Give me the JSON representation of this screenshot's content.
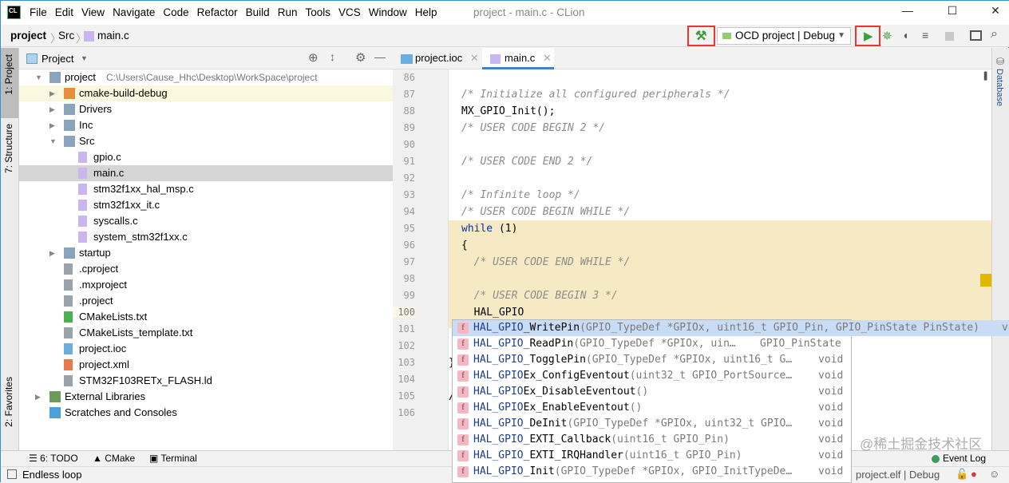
{
  "window": {
    "title": "project - main.c - CLion",
    "logo": "CL"
  },
  "menu": [
    "File",
    "Edit",
    "View",
    "Navigate",
    "Code",
    "Refactor",
    "Build",
    "Run",
    "Tools",
    "VCS",
    "Window",
    "Help"
  ],
  "breadcrumb": [
    "project",
    "Src",
    "main.c"
  ],
  "toolbar": {
    "run_config": "OCD project | Debug",
    "icons": [
      "hammer-build-icon",
      "run-icon",
      "debug-icon",
      "coverage-icon",
      "profile-icon",
      "stop-icon",
      "terminal-icon",
      "search-icon"
    ],
    "highlight_color": "#e33333"
  },
  "project_pane": {
    "title": "Project",
    "tree": [
      {
        "label": "project",
        "extra": "C:\\Users\\Cause_Hhc\\Desktop\\WorkSpace\\project",
        "depth": 0,
        "arrow": "down",
        "icon": "folder"
      },
      {
        "label": "cmake-build-debug",
        "depth": 1,
        "arrow": "right",
        "icon": "folder-orange"
      },
      {
        "label": "Drivers",
        "depth": 1,
        "arrow": "right",
        "icon": "folder"
      },
      {
        "label": "Inc",
        "depth": 1,
        "arrow": "right",
        "icon": "folder"
      },
      {
        "label": "Src",
        "depth": 1,
        "arrow": "down",
        "icon": "folder"
      },
      {
        "label": "gpio.c",
        "depth": 2,
        "icon": "c-file"
      },
      {
        "label": "main.c",
        "depth": 2,
        "icon": "c-file",
        "selected": true
      },
      {
        "label": "stm32f1xx_hal_msp.c",
        "depth": 2,
        "icon": "c-file"
      },
      {
        "label": "stm32f1xx_it.c",
        "depth": 2,
        "icon": "c-file"
      },
      {
        "label": "syscalls.c",
        "depth": 2,
        "icon": "c-file"
      },
      {
        "label": "system_stm32f1xx.c",
        "depth": 2,
        "icon": "c-file"
      },
      {
        "label": "startup",
        "depth": 1,
        "arrow": "right",
        "icon": "folder"
      },
      {
        "label": ".cproject",
        "depth": 1,
        "icon": "text-file"
      },
      {
        "label": ".mxproject",
        "depth": 1,
        "icon": "text-file"
      },
      {
        "label": ".project",
        "depth": 1,
        "icon": "text-file"
      },
      {
        "label": "CMakeLists.txt",
        "depth": 1,
        "icon": "cmake-file"
      },
      {
        "label": "CMakeLists_template.txt",
        "depth": 1,
        "icon": "text-file"
      },
      {
        "label": "project.ioc",
        "depth": 1,
        "icon": "ioc-file"
      },
      {
        "label": "project.xml",
        "depth": 1,
        "icon": "xml-file"
      },
      {
        "label": "STM32F103RETx_FLASH.ld",
        "depth": 1,
        "icon": "text-file"
      },
      {
        "label": "External Libraries",
        "depth": 0,
        "arrow": "right",
        "icon": "library"
      },
      {
        "label": "Scratches and Consoles",
        "depth": 0,
        "icon": "scratches"
      }
    ]
  },
  "side_tabs": {
    "left": [
      "1: Project",
      "7: Structure",
      "2: Favorites"
    ],
    "right": [
      "Database"
    ]
  },
  "editor": {
    "tabs": [
      {
        "label": "project.ioc",
        "active": false
      },
      {
        "label": "main.c",
        "active": true
      }
    ],
    "lines": [
      {
        "n": "86",
        "t": ""
      },
      {
        "n": "87",
        "t": "/* Initialize all configured peripherals */",
        "c": "cm"
      },
      {
        "n": "88",
        "t": "MX_GPIO_Init();"
      },
      {
        "n": "89",
        "t": "/* USER CODE BEGIN 2 */",
        "c": "cm"
      },
      {
        "n": "90",
        "t": ""
      },
      {
        "n": "91",
        "t": "/* USER CODE END 2 */",
        "c": "cm"
      },
      {
        "n": "92",
        "t": ""
      },
      {
        "n": "93",
        "t": "/* Infinite loop */",
        "c": "cm"
      },
      {
        "n": "94",
        "t": "/* USER CODE BEGIN WHILE */",
        "c": "cm"
      },
      {
        "n": "95",
        "t": "while (1)",
        "c": "kw"
      },
      {
        "n": "96",
        "t": "{"
      },
      {
        "n": "97",
        "t": "  /* USER CODE END WHILE */",
        "c": "cm"
      },
      {
        "n": "98",
        "t": ""
      },
      {
        "n": "99",
        "t": "  /* USER CODE BEGIN 3 */",
        "c": "cm"
      },
      {
        "n": "100",
        "t": "  HAL_GPIO"
      },
      {
        "n": "101",
        "t": ""
      },
      {
        "n": "102",
        "t": ""
      },
      {
        "n": "103",
        "t": "}"
      },
      {
        "n": "104",
        "t": ""
      },
      {
        "n": "105",
        "t": "/"
      },
      {
        "n": "106",
        "t": ""
      }
    ]
  },
  "completion": [
    {
      "prefix": "HAL_GPIO",
      "rest": "_WritePin",
      "sig": "(GPIO_TypeDef *GPIOx, uint16_t GPIO_Pin, GPIO_PinState PinState)",
      "ret": "v"
    },
    {
      "prefix": "HAL_GPIO",
      "rest": "_ReadPin",
      "sig": "(GPIO_TypeDef *GPIOx, uin…",
      "ret": "GPIO_PinState"
    },
    {
      "prefix": "HAL_GPIO",
      "rest": "_TogglePin",
      "sig": "(GPIO_TypeDef *GPIOx, uint16_t G…",
      "ret": "void"
    },
    {
      "prefix": "HAL_GPIO",
      "rest": "Ex_ConfigEventout",
      "sig": "(uint32_t GPIO_PortSource…",
      "ret": "void"
    },
    {
      "prefix": "HAL_GPIO",
      "rest": "Ex_DisableEventout",
      "sig": "()",
      "ret": "void"
    },
    {
      "prefix": "HAL_GPIO",
      "rest": "Ex_EnableEventout",
      "sig": "()",
      "ret": "void"
    },
    {
      "prefix": "HAL_GPIO",
      "rest": "_DeInit",
      "sig": "(GPIO_TypeDef *GPIOx, uint32_t GPIO…",
      "ret": "void"
    },
    {
      "prefix": "HAL_GPIO",
      "rest": "_EXTI_Callback",
      "sig": "(uint16_t GPIO_Pin)",
      "ret": "void"
    },
    {
      "prefix": "HAL_GPIO",
      "rest": "_EXTI_IRQHandler",
      "sig": "(uint16_t GPIO_Pin)",
      "ret": "void"
    },
    {
      "prefix": "HAL_GPIO",
      "rest": "_Init",
      "sig": "(GPIO_TypeDef *GPIOx, GPIO_InitTypeDe…",
      "ret": "void"
    }
  ],
  "bottom_tabs": [
    "6: TODO",
    "CMake",
    "Terminal",
    "Event Log"
  ],
  "status": {
    "message": "Endless loop",
    "context": "project.elf | Debug"
  },
  "watermark": "@稀土掘金技术社区"
}
